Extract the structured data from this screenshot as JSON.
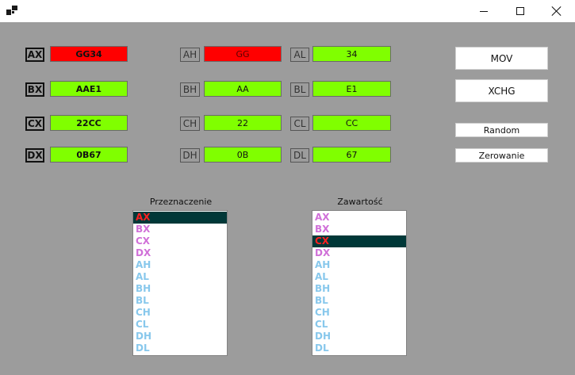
{
  "window": {
    "icon": "app-window-icon",
    "controls": [
      "minimize-icon",
      "maximize-icon",
      "close-icon"
    ]
  },
  "registers": {
    "ax": {
      "label": "AX",
      "value": "GG34"
    },
    "bx": {
      "label": "BX",
      "value": "AAE1"
    },
    "cx": {
      "label": "CX",
      "value": "22CC"
    },
    "dx": {
      "label": "DX",
      "value": "0B67"
    },
    "ah": {
      "label": "AH",
      "value": "GG"
    },
    "al": {
      "label": "AL",
      "value": "34"
    },
    "bh": {
      "label": "BH",
      "value": "AA"
    },
    "bl": {
      "label": "BL",
      "value": "E1"
    },
    "ch": {
      "label": "CH",
      "value": "22"
    },
    "cl": {
      "label": "CL",
      "value": "CC"
    },
    "dh": {
      "label": "DH",
      "value": "0B"
    },
    "dl": {
      "label": "DL",
      "value": "67"
    }
  },
  "buttons": {
    "mov": "MOV",
    "xchg": "XCHG",
    "random": "Random",
    "zerowanie": "Zerowanie"
  },
  "destination": {
    "title": "Przeznaczenie",
    "items": [
      "AX",
      "BX",
      "CX",
      "DX",
      "AH",
      "AL",
      "BH",
      "BL",
      "CH",
      "CL",
      "DH",
      "DL"
    ],
    "selected": "AX"
  },
  "source": {
    "title": "Zawartość",
    "items": [
      "AX",
      "BX",
      "CX",
      "DX",
      "AH",
      "AL",
      "BH",
      "BL",
      "CH",
      "CL",
      "DH",
      "DL"
    ],
    "selected": "CX"
  },
  "colors": {
    "valid": "#80ff00",
    "invalid": "#ff0000",
    "background": "#9c9c9c",
    "list16bit": "#d070d8",
    "list8bit": "#88c8ec",
    "selection": "#003838"
  }
}
